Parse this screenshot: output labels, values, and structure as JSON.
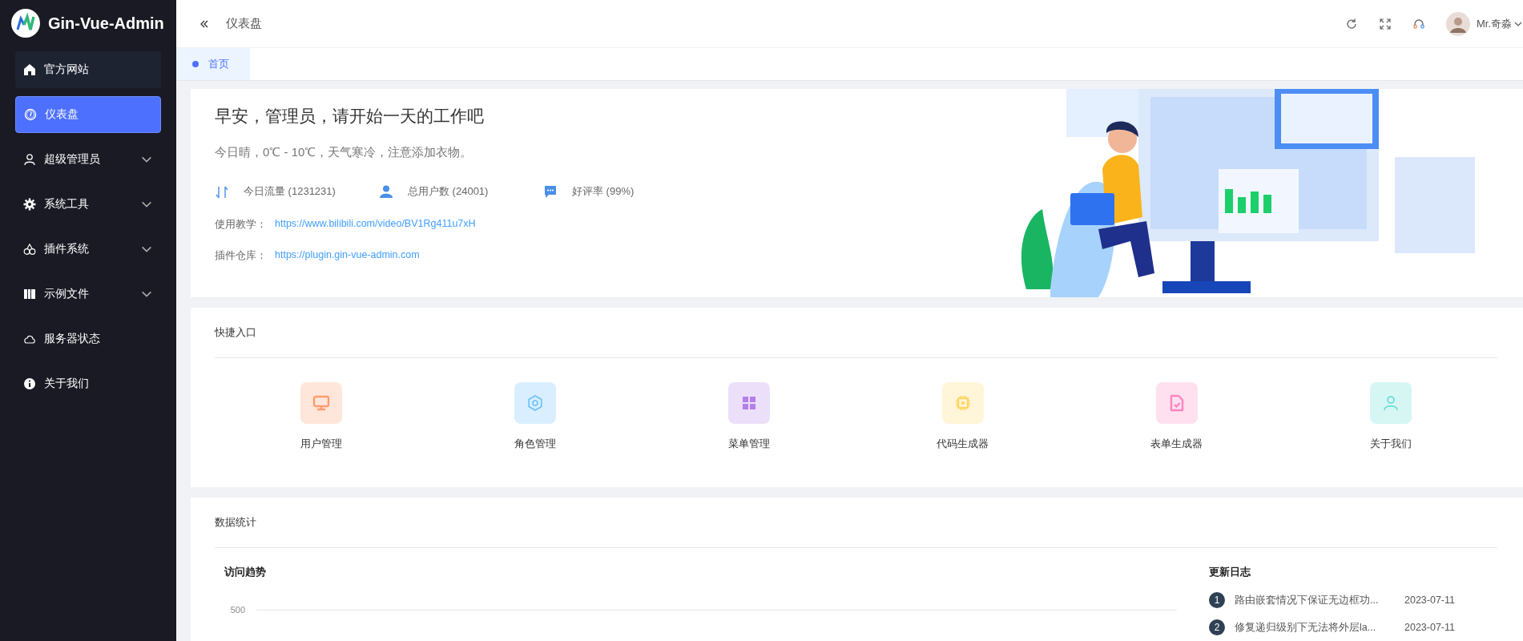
{
  "sidebar": {
    "logo_text": "Gin-Vue-Admin",
    "items": [
      {
        "label": "官方网站",
        "selected": false,
        "hovered": true,
        "expandable": false
      },
      {
        "label": "仪表盘",
        "selected": true,
        "hovered": false,
        "expandable": false
      },
      {
        "label": "超级管理员",
        "selected": false,
        "hovered": false,
        "expandable": true
      },
      {
        "label": "系统工具",
        "selected": false,
        "hovered": false,
        "expandable": true
      },
      {
        "label": "插件系统",
        "selected": false,
        "hovered": false,
        "expandable": true
      },
      {
        "label": "示例文件",
        "selected": false,
        "hovered": false,
        "expandable": true
      },
      {
        "label": "服务器状态",
        "selected": false,
        "hovered": false,
        "expandable": false
      },
      {
        "label": "关于我们",
        "selected": false,
        "hovered": false,
        "expandable": false
      }
    ]
  },
  "header": {
    "breadcrumb": "仪表盘",
    "user_name": "Mr.奇淼"
  },
  "tabs": [
    {
      "label": "首页",
      "selected": true
    }
  ],
  "welcome": {
    "title": "早安，管理员，请开始一天的工作吧",
    "subtitle": "今日晴，0℃ - 10℃，天气寒冷，注意添加衣物。",
    "stats": [
      {
        "label": "今日流量 (1231231)"
      },
      {
        "label": "总用户数 (24001)"
      },
      {
        "label": "好评率 (99%)"
      }
    ],
    "links": [
      {
        "label": "使用教学：",
        "url": "https://www.bilibili.com/video/BV1Rg411u7xH"
      },
      {
        "label": "插件仓库：",
        "url": "https://plugin.gin-vue-admin.com"
      }
    ]
  },
  "quick_entry": {
    "title": "快捷入口",
    "items": [
      {
        "label": "用户管理",
        "color": "#ff9c6e"
      },
      {
        "label": "角色管理",
        "color": "#69c0ff"
      },
      {
        "label": "菜单管理",
        "color": "#b37feb"
      },
      {
        "label": "代码生成器",
        "color": "#ffd666"
      },
      {
        "label": "表单生成器",
        "color": "#ff85c0"
      },
      {
        "label": "关于我们",
        "color": "#5cdbd3"
      }
    ]
  },
  "statistics": {
    "title": "数据统计",
    "chart_title": "访问趋势",
    "y_tick": "500",
    "changelog": {
      "title": "更新日志",
      "items": [
        {
          "number": "1",
          "text": "路由嵌套情况下保证无边框功...",
          "date": "2023-07-11"
        },
        {
          "number": "2",
          "text": "修复递归级别下无法将外层la...",
          "date": "2023-07-11"
        }
      ]
    }
  }
}
